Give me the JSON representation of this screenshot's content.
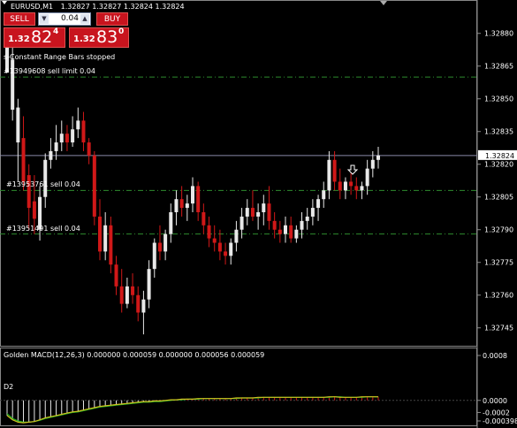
{
  "header": {
    "symbol": "EURUSD,M1",
    "ohlc": "1.32827 1.32827 1.32824 1.32824"
  },
  "trade_panel": {
    "sell_label": "SELL",
    "buy_label": "BUY",
    "lot_value": "0.04",
    "sell_quote": {
      "small": "1.32",
      "big": "82",
      "sup": "4"
    },
    "buy_quote": {
      "small": "1.32",
      "big": "83",
      "sup": "0"
    }
  },
  "status_text": "s-Constant Range Bars stopped",
  "order_labels": [
    {
      "text": "#13949608 sell limit 0.04",
      "price": 1.3286
    },
    {
      "text": "#13953761 sell 0.04",
      "price": 1.32808
    },
    {
      "text": "#13951491 sell 0.04",
      "price": 1.32788
    }
  ],
  "price_axis": {
    "ticks": [
      "1.32880",
      "1.32865",
      "1.32850",
      "1.32835",
      "1.32820",
      "1.32805",
      "1.32790",
      "1.32775",
      "1.32760",
      "1.32745"
    ],
    "current_price": "1.32824"
  },
  "indicator": {
    "title": "Golden MACD(12,26,3) 0.000000 0.000059 0.000000 0.000056 0.000059",
    "axis_ticks": [
      "0.0008",
      "0.0000",
      "-0.0002",
      "-0.000398"
    ],
    "left_label": "D2"
  },
  "colors": {
    "bull": "#e8e8e8",
    "bear": "#d01818",
    "order_line": "#2e8b2e",
    "macd_line": "#d0c020",
    "signal_line": "#20b020",
    "hist_pos": "#d01818",
    "hist_neg": "#e8e8e8",
    "panel_red": "#c8141e"
  },
  "icons": {
    "corner": "triangle-down-icon",
    "arrow": "down-arrow-icon"
  },
  "chart_data": {
    "type": "candlestick",
    "symbol": "EURUSD",
    "timeframe": "M1",
    "ylim": [
      1.32738,
      1.32888
    ],
    "candles": [
      [
        1.32862,
        1.3288,
        1.32862,
        1.32875
      ],
      [
        1.32845,
        1.3288,
        1.3284,
        1.32868
      ],
      [
        1.3283,
        1.3285,
        1.32812,
        1.32846
      ],
      [
        1.32832,
        1.32842,
        1.32808,
        1.32812
      ],
      [
        1.32815,
        1.3282,
        1.3279,
        1.328
      ],
      [
        1.32803,
        1.32815,
        1.32788,
        1.32795
      ],
      [
        1.3279,
        1.3281,
        1.32785,
        1.32805
      ],
      [
        1.32805,
        1.32825,
        1.328,
        1.32822
      ],
      [
        1.32822,
        1.32832,
        1.32818,
        1.32826
      ],
      [
        1.32826,
        1.32838,
        1.32822,
        1.3283
      ],
      [
        1.3283,
        1.3284,
        1.32826,
        1.32834
      ],
      [
        1.32834,
        1.32838,
        1.32826,
        1.3283
      ],
      [
        1.3283,
        1.32842,
        1.32828,
        1.32836
      ],
      [
        1.32836,
        1.32846,
        1.32832,
        1.3284
      ],
      [
        1.3284,
        1.32844,
        1.32826,
        1.3283
      ],
      [
        1.3283,
        1.32832,
        1.3282,
        1.32824
      ],
      [
        1.32824,
        1.32826,
        1.32792,
        1.32796
      ],
      [
        1.32796,
        1.32804,
        1.32776,
        1.3278
      ],
      [
        1.3278,
        1.32798,
        1.32776,
        1.32792
      ],
      [
        1.32792,
        1.32796,
        1.3277,
        1.32774
      ],
      [
        1.32774,
        1.32778,
        1.3276,
        1.32764
      ],
      [
        1.32764,
        1.32772,
        1.32752,
        1.32756
      ],
      [
        1.32756,
        1.32768,
        1.32754,
        1.32764
      ],
      [
        1.32764,
        1.3277,
        1.32756,
        1.3276
      ],
      [
        1.3276,
        1.32764,
        1.32748,
        1.32752
      ],
      [
        1.32752,
        1.32762,
        1.32742,
        1.32758
      ],
      [
        1.32758,
        1.32776,
        1.32754,
        1.32772
      ],
      [
        1.32772,
        1.32786,
        1.32768,
        1.32784
      ],
      [
        1.32784,
        1.32792,
        1.32776,
        1.3278
      ],
      [
        1.3278,
        1.3279,
        1.32776,
        1.32788
      ],
      [
        1.32788,
        1.32802,
        1.32784,
        1.32798
      ],
      [
        1.32798,
        1.32808,
        1.32792,
        1.32804
      ],
      [
        1.32804,
        1.3281,
        1.32796,
        1.328
      ],
      [
        1.328,
        1.32806,
        1.32794,
        1.32802
      ],
      [
        1.32802,
        1.32814,
        1.32798,
        1.3281
      ],
      [
        1.3281,
        1.32812,
        1.32794,
        1.32798
      ],
      [
        1.32798,
        1.32802,
        1.32788,
        1.32792
      ],
      [
        1.32792,
        1.32796,
        1.32782,
        1.32786
      ],
      [
        1.32786,
        1.32792,
        1.3278,
        1.32784
      ],
      [
        1.32784,
        1.3279,
        1.32776,
        1.3278
      ],
      [
        1.3278,
        1.32784,
        1.32774,
        1.32778
      ],
      [
        1.32778,
        1.32786,
        1.32774,
        1.32784
      ],
      [
        1.32784,
        1.32794,
        1.3278,
        1.3279
      ],
      [
        1.3279,
        1.328,
        1.32786,
        1.32796
      ],
      [
        1.32796,
        1.32804,
        1.32792,
        1.328
      ],
      [
        1.328,
        1.32808,
        1.32794,
        1.32796
      ],
      [
        1.32796,
        1.32802,
        1.3279,
        1.32798
      ],
      [
        1.32798,
        1.32806,
        1.32792,
        1.32802
      ],
      [
        1.32802,
        1.3281,
        1.3279,
        1.32794
      ],
      [
        1.32794,
        1.32798,
        1.32786,
        1.3279
      ],
      [
        1.3279,
        1.32794,
        1.32784,
        1.32788
      ],
      [
        1.32788,
        1.32796,
        1.32784,
        1.32792
      ],
      [
        1.32792,
        1.32796,
        1.32784,
        1.32786
      ],
      [
        1.32786,
        1.32792,
        1.32784,
        1.3279
      ],
      [
        1.3279,
        1.32798,
        1.32786,
        1.32794
      ],
      [
        1.32794,
        1.328,
        1.3279,
        1.32796
      ],
      [
        1.32796,
        1.32804,
        1.32792,
        1.328
      ],
      [
        1.328,
        1.32806,
        1.32794,
        1.32804
      ],
      [
        1.32804,
        1.32812,
        1.328,
        1.32808
      ],
      [
        1.32808,
        1.32826,
        1.32804,
        1.32822
      ],
      [
        1.32822,
        1.32826,
        1.32808,
        1.32812
      ],
      [
        1.32812,
        1.32818,
        1.32804,
        1.32808
      ],
      [
        1.32808,
        1.32814,
        1.32804,
        1.32812
      ],
      [
        1.32812,
        1.32816,
        1.32806,
        1.3281
      ],
      [
        1.3281,
        1.32814,
        1.32804,
        1.32808
      ],
      [
        1.32808,
        1.32812,
        1.32804,
        1.3281
      ],
      [
        1.3281,
        1.32822,
        1.32806,
        1.32818
      ],
      [
        1.32818,
        1.32826,
        1.32814,
        1.32822
      ],
      [
        1.32822,
        1.32828,
        1.32818,
        1.32824
      ]
    ],
    "order_lines": [
      1.3286,
      1.32808,
      1.32788
    ],
    "current_price": 1.32824,
    "macd": {
      "ylim": [
        -0.000398,
        0.0008
      ],
      "histogram": [
        -0.00025,
        -0.00032,
        -0.00036,
        -0.00037,
        -0.00036,
        -0.00035,
        -0.00032,
        -0.00029,
        -0.00027,
        -0.00025,
        -0.00023,
        -0.00021,
        -0.00019,
        -0.00018,
        -0.00016,
        -0.00014,
        -0.00012,
        -0.0001,
        -9e-05,
        -8e-05,
        -7e-05,
        -6e-05,
        -5e-05,
        -4e-05,
        -3e-05,
        -2e-05,
        -2e-05,
        -1e-05,
        -1e-05,
        0.0,
        1e-05,
        1e-05,
        2e-05,
        2e-05,
        2e-05,
        3e-05,
        3e-05,
        3e-05,
        3e-05,
        3e-05,
        3e-05,
        3e-05,
        4e-05,
        4e-05,
        4e-05,
        4e-05,
        5e-05,
        5e-05,
        5e-05,
        5e-05,
        5e-05,
        5e-05,
        5e-05,
        5e-05,
        5e-05,
        5e-05,
        5e-05,
        5e-05,
        5e-05,
        6e-05,
        6e-05,
        5e-05,
        5e-05,
        5e-05,
        5e-05,
        6e-05,
        6e-05,
        6e-05,
        5.9e-05
      ],
      "signal": [
        -0.00022,
        -0.0003,
        -0.00034,
        -0.00036,
        -0.00036,
        -0.00035,
        -0.00033,
        -0.0003,
        -0.00028,
        -0.00026,
        -0.00024,
        -0.00022,
        -0.0002,
        -0.00019,
        -0.00017,
        -0.00015,
        -0.00013,
        -0.00011,
        -0.0001,
        -9e-05,
        -8e-05,
        -7e-05,
        -6e-05,
        -5e-05,
        -4e-05,
        -3e-05,
        -3e-05,
        -2e-05,
        -2e-05,
        -1e-05,
        0.0,
        1e-05,
        1e-05,
        2e-05,
        2e-05,
        2e-05,
        3e-05,
        3e-05,
        3e-05,
        3e-05,
        3e-05,
        3e-05,
        3e-05,
        4e-05,
        4e-05,
        4e-05,
        4e-05,
        5e-05,
        5e-05,
        5e-05,
        5e-05,
        5e-05,
        5e-05,
        5e-05,
        5e-05,
        5e-05,
        5e-05,
        5e-05,
        5e-05,
        5e-05,
        6e-05,
        6e-05,
        5e-05,
        5e-05,
        5e-05,
        5e-05,
        6e-05,
        6e-05,
        5.6e-05
      ]
    }
  }
}
